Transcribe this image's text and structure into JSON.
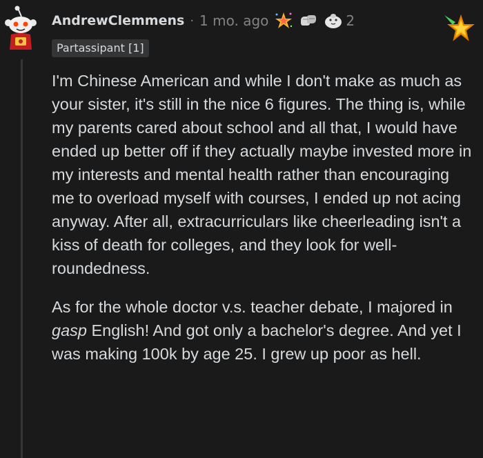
{
  "comment": {
    "author": "AndrewClemmens",
    "separator": "·",
    "time_ago": "1 mo. ago",
    "awards": [
      {
        "icon": "starstruck-award-icon"
      },
      {
        "icon": "fist-bump-award-icon"
      },
      {
        "icon": "wholesome-seal-award-icon",
        "count": "2"
      }
    ],
    "flair": "Partassipant [1]",
    "badge_icon": "gold-star-badge-icon",
    "paragraph1": "I'm Chinese American and while I don't make as much as your sister, it's still in the nice 6 figures. The thing is, while my parents cared about school and all that, I would have ended up better off if they actually maybe invested more in my interests and mental health rather than encouraging me to overload myself with courses, I ended up not acing anyway. After all, extracurriculars like cheerleading isn't a kiss of death for colleges, and they look for well-roundedness.",
    "paragraph2_before": "As for the whole doctor v.s. teacher debate, I majored in ",
    "paragraph2_emph": "gasp",
    "paragraph2_after": " English! And got only a bachelor's degree. And yet I was making 100k by age 25. I grew up poor as hell."
  },
  "colors": {
    "background": "#1a1a1b",
    "text": "#d7dadc",
    "meta": "#818384",
    "flair_bg": "#343536"
  }
}
